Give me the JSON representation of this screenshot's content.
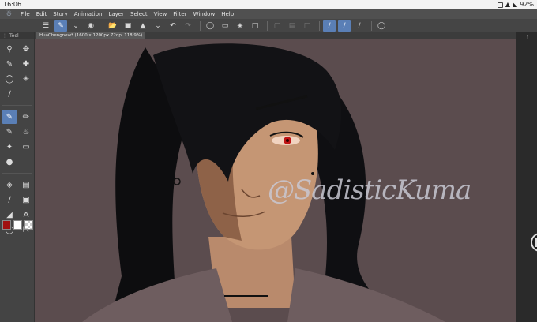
{
  "status": {
    "time": "16:06",
    "battery": "92%"
  },
  "menu": [
    "File",
    "Edit",
    "Story",
    "Animation",
    "Layer",
    "Select",
    "View",
    "Filter",
    "Window",
    "Help"
  ],
  "command_icons": [
    "menu-icon",
    "pen-tool-icon",
    "chevron-down-icon",
    "camera-icon",
    "folder-open-icon",
    "save-icon",
    "export-icon",
    "chevron-down-icon",
    "undo-icon",
    "redo-icon",
    "marquee-icon",
    "eraser-selection-icon",
    "fill-icon",
    "transform-icon",
    "deselect-icon",
    "invert-icon",
    "clear-icon",
    "ruler-snap-icon",
    "ruler-snap-2-icon",
    "ruler-icon",
    "special-ruler-icon"
  ],
  "tool_panel": {
    "label": "Tool"
  },
  "document_tab": "HuaChengnew* (1600 x 1200px 72dpi 118.9%)",
  "colors": {
    "main": "#a01010",
    "sub": "#ffffff",
    "accent": "#5a7fb6",
    "canvas_bg": "#5b4c4e"
  },
  "watermark": "@SadisticKuma"
}
